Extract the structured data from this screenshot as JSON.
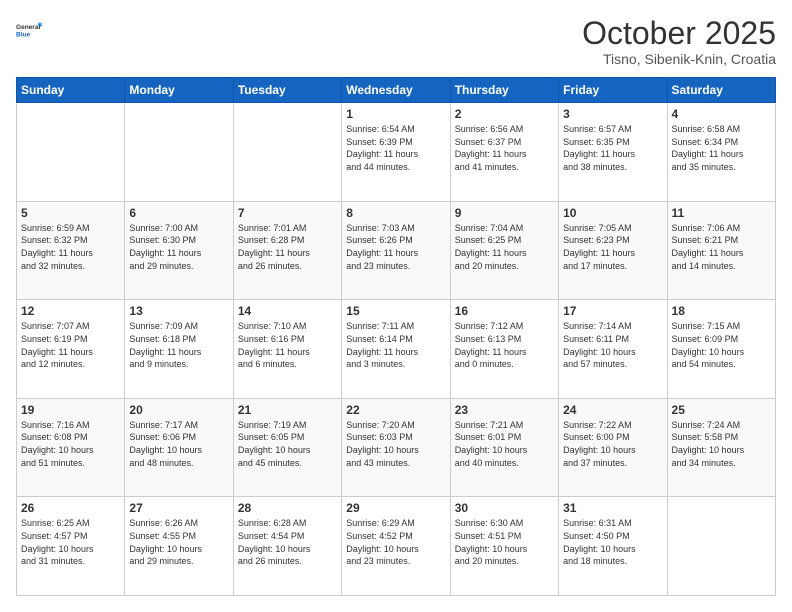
{
  "logo": {
    "general": "General",
    "blue": "Blue"
  },
  "header": {
    "month": "October 2025",
    "location": "Tisno, Sibenik-Knin, Croatia"
  },
  "days_of_week": [
    "Sunday",
    "Monday",
    "Tuesday",
    "Wednesday",
    "Thursday",
    "Friday",
    "Saturday"
  ],
  "weeks": [
    [
      {
        "day": "",
        "info": ""
      },
      {
        "day": "",
        "info": ""
      },
      {
        "day": "",
        "info": ""
      },
      {
        "day": "1",
        "info": "Sunrise: 6:54 AM\nSunset: 6:39 PM\nDaylight: 11 hours\nand 44 minutes."
      },
      {
        "day": "2",
        "info": "Sunrise: 6:56 AM\nSunset: 6:37 PM\nDaylight: 11 hours\nand 41 minutes."
      },
      {
        "day": "3",
        "info": "Sunrise: 6:57 AM\nSunset: 6:35 PM\nDaylight: 11 hours\nand 38 minutes."
      },
      {
        "day": "4",
        "info": "Sunrise: 6:58 AM\nSunset: 6:34 PM\nDaylight: 11 hours\nand 35 minutes."
      }
    ],
    [
      {
        "day": "5",
        "info": "Sunrise: 6:59 AM\nSunset: 6:32 PM\nDaylight: 11 hours\nand 32 minutes."
      },
      {
        "day": "6",
        "info": "Sunrise: 7:00 AM\nSunset: 6:30 PM\nDaylight: 11 hours\nand 29 minutes."
      },
      {
        "day": "7",
        "info": "Sunrise: 7:01 AM\nSunset: 6:28 PM\nDaylight: 11 hours\nand 26 minutes."
      },
      {
        "day": "8",
        "info": "Sunrise: 7:03 AM\nSunset: 6:26 PM\nDaylight: 11 hours\nand 23 minutes."
      },
      {
        "day": "9",
        "info": "Sunrise: 7:04 AM\nSunset: 6:25 PM\nDaylight: 11 hours\nand 20 minutes."
      },
      {
        "day": "10",
        "info": "Sunrise: 7:05 AM\nSunset: 6:23 PM\nDaylight: 11 hours\nand 17 minutes."
      },
      {
        "day": "11",
        "info": "Sunrise: 7:06 AM\nSunset: 6:21 PM\nDaylight: 11 hours\nand 14 minutes."
      }
    ],
    [
      {
        "day": "12",
        "info": "Sunrise: 7:07 AM\nSunset: 6:19 PM\nDaylight: 11 hours\nand 12 minutes."
      },
      {
        "day": "13",
        "info": "Sunrise: 7:09 AM\nSunset: 6:18 PM\nDaylight: 11 hours\nand 9 minutes."
      },
      {
        "day": "14",
        "info": "Sunrise: 7:10 AM\nSunset: 6:16 PM\nDaylight: 11 hours\nand 6 minutes."
      },
      {
        "day": "15",
        "info": "Sunrise: 7:11 AM\nSunset: 6:14 PM\nDaylight: 11 hours\nand 3 minutes."
      },
      {
        "day": "16",
        "info": "Sunrise: 7:12 AM\nSunset: 6:13 PM\nDaylight: 11 hours\nand 0 minutes."
      },
      {
        "day": "17",
        "info": "Sunrise: 7:14 AM\nSunset: 6:11 PM\nDaylight: 10 hours\nand 57 minutes."
      },
      {
        "day": "18",
        "info": "Sunrise: 7:15 AM\nSunset: 6:09 PM\nDaylight: 10 hours\nand 54 minutes."
      }
    ],
    [
      {
        "day": "19",
        "info": "Sunrise: 7:16 AM\nSunset: 6:08 PM\nDaylight: 10 hours\nand 51 minutes."
      },
      {
        "day": "20",
        "info": "Sunrise: 7:17 AM\nSunset: 6:06 PM\nDaylight: 10 hours\nand 48 minutes."
      },
      {
        "day": "21",
        "info": "Sunrise: 7:19 AM\nSunset: 6:05 PM\nDaylight: 10 hours\nand 45 minutes."
      },
      {
        "day": "22",
        "info": "Sunrise: 7:20 AM\nSunset: 6:03 PM\nDaylight: 10 hours\nand 43 minutes."
      },
      {
        "day": "23",
        "info": "Sunrise: 7:21 AM\nSunset: 6:01 PM\nDaylight: 10 hours\nand 40 minutes."
      },
      {
        "day": "24",
        "info": "Sunrise: 7:22 AM\nSunset: 6:00 PM\nDaylight: 10 hours\nand 37 minutes."
      },
      {
        "day": "25",
        "info": "Sunrise: 7:24 AM\nSunset: 5:58 PM\nDaylight: 10 hours\nand 34 minutes."
      }
    ],
    [
      {
        "day": "26",
        "info": "Sunrise: 6:25 AM\nSunset: 4:57 PM\nDaylight: 10 hours\nand 31 minutes."
      },
      {
        "day": "27",
        "info": "Sunrise: 6:26 AM\nSunset: 4:55 PM\nDaylight: 10 hours\nand 29 minutes."
      },
      {
        "day": "28",
        "info": "Sunrise: 6:28 AM\nSunset: 4:54 PM\nDaylight: 10 hours\nand 26 minutes."
      },
      {
        "day": "29",
        "info": "Sunrise: 6:29 AM\nSunset: 4:52 PM\nDaylight: 10 hours\nand 23 minutes."
      },
      {
        "day": "30",
        "info": "Sunrise: 6:30 AM\nSunset: 4:51 PM\nDaylight: 10 hours\nand 20 minutes."
      },
      {
        "day": "31",
        "info": "Sunrise: 6:31 AM\nSunset: 4:50 PM\nDaylight: 10 hours\nand 18 minutes."
      },
      {
        "day": "",
        "info": ""
      }
    ]
  ]
}
